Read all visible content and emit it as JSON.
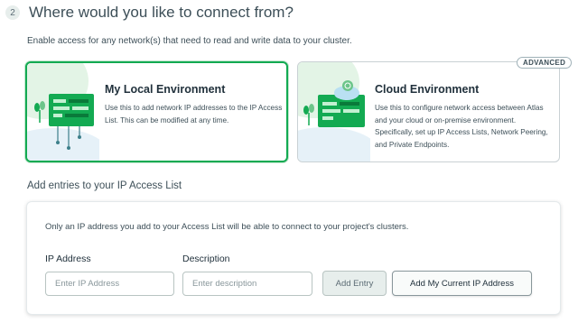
{
  "step": {
    "number": "2",
    "title": "Where would you like to connect from?"
  },
  "intro": "Enable access for any network(s) that need to read and write data to your cluster.",
  "options": {
    "local": {
      "title": "My Local Environment",
      "description": "Use this to add network IP addresses to the IP Access List. This can be modified at any time.",
      "selected": true,
      "icon": "local-network-illustration"
    },
    "cloud": {
      "title": "Cloud Environment",
      "description": "Use this to configure network access between Atlas and your cloud or on-premise environment. Specifically, set up IP Access Lists, Network Peering, and Private Endpoints.",
      "badge": "ADVANCED",
      "icon": "cloud-network-illustration"
    }
  },
  "access_list": {
    "section_title": "Add entries to your IP Access List",
    "note": "Only an IP address you add to your Access List will be able to connect to your project's clusters.",
    "ip_label": "IP Address",
    "ip_placeholder": "Enter IP Address",
    "ip_value": "",
    "description_label": "Description",
    "description_placeholder": "Enter description",
    "description_value": "",
    "add_entry_label": "Add Entry",
    "add_current_ip_label": "Add My Current IP Address"
  },
  "colors": {
    "accent_green": "#13aa52",
    "text": "#21313c"
  }
}
